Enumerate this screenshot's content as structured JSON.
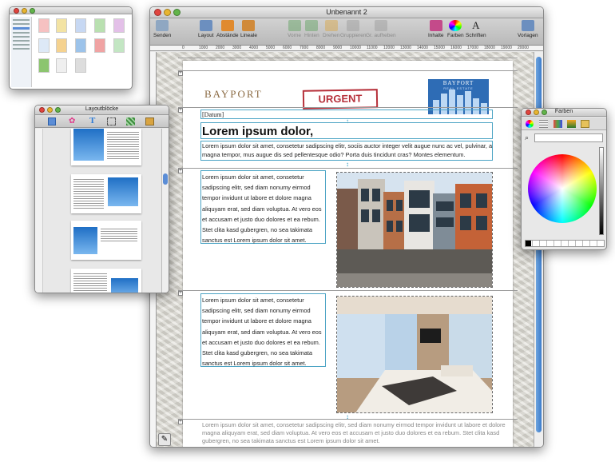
{
  "main_window": {
    "title": "Unbenannt 2",
    "toolbar": [
      {
        "label": "Senden",
        "icon": "send-icon",
        "enabled": true
      },
      {
        "label": "Layout",
        "icon": "layout-icon",
        "enabled": true
      },
      {
        "label": "Abstände",
        "icon": "spacing-icon",
        "enabled": true
      },
      {
        "label": "Lineale",
        "icon": "rulers-icon",
        "enabled": true
      },
      {
        "label": "Vorne",
        "icon": "bring-front-icon",
        "enabled": false
      },
      {
        "label": "Hinten",
        "icon": "send-back-icon",
        "enabled": false
      },
      {
        "label": "Drehen",
        "icon": "rotate-icon",
        "enabled": false
      },
      {
        "label": "Gruppieren",
        "icon": "group-icon",
        "enabled": false
      },
      {
        "label": "Gr. aufheben",
        "icon": "ungroup-icon",
        "enabled": false
      },
      {
        "label": "Inhalte",
        "icon": "contents-icon",
        "enabled": true
      },
      {
        "label": "Farben",
        "icon": "colors-icon",
        "enabled": true
      },
      {
        "label": "Schriften",
        "icon": "fonts-icon",
        "enabled": true
      },
      {
        "label": "Vorlagen",
        "icon": "templates-icon",
        "enabled": true
      }
    ],
    "ruler_marks": [
      "0",
      "1000",
      "2000",
      "3000",
      "4000",
      "5000",
      "6000",
      "7000",
      "8000",
      "9000",
      "10000",
      "11000",
      "12000",
      "13000",
      "14000",
      "15000",
      "16000",
      "17000",
      "18000",
      "19000",
      "20000"
    ]
  },
  "document": {
    "company_name": "BAYPORT",
    "stamp": "URGENT",
    "logo": {
      "name": "BAYPORT",
      "subtitle": "REAL ESTATE"
    },
    "date_field": "[Datum]",
    "headline": "Lorem ipsum dolor,",
    "intro": "Lorem ipsum dolor sit amet, consetetur sadipscing elitr, sociis auctor integer velit augue nunc ac vel, pulvinar, a magna tempor, mus augue dis sed pellentesque odio? Porta duis tincidunt cras? Montes elementum.",
    "column_1": "Lorem ipsum dolor sit amet, consetetur sadipscing elitr, sed diam nonumy eirmod tempor invidunt ut labore et dolore magna aliquyam erat, sed diam voluptua. At vero eos et accusam et justo duo dolores et ea rebum. Stet clita kasd gubergren, no sea takimata sanctus est Lorem ipsum dolor sit amet.",
    "column_2": "Lorem ipsum dolor sit amet, consetetur sadipscing elitr, sed diam nonumy eirmod tempor invidunt ut labore et dolore magna aliquyam erat, sed diam voluptua. At vero eos et accusam et justo duo dolores et ea rebum. Stet clita kasd gubergren, no sea takimata sanctus est Lorem ipsum dolor sit amet.",
    "footer_text": "Lorem ipsum dolor sit amet, consetetur sadipscing elitr, sed diam nonumy eirmod tempor invidunt ut labore et dolore magna aliquyam erat, sed diam voluptua. At vero eos et accusam et justo duo dolores et ea rebum. Stet clita kasd gubergren, no sea takimata sanctus est Lorem ipsum dolor sit amet."
  },
  "layout_panel": {
    "title": "Layoutblöcke"
  },
  "colors_panel": {
    "title": "Farben"
  },
  "colors": {
    "accent": "#4aa3c4",
    "stamp": "#b6303a",
    "brand": "#2e6cb5",
    "brand_text": "#8b6b44"
  }
}
